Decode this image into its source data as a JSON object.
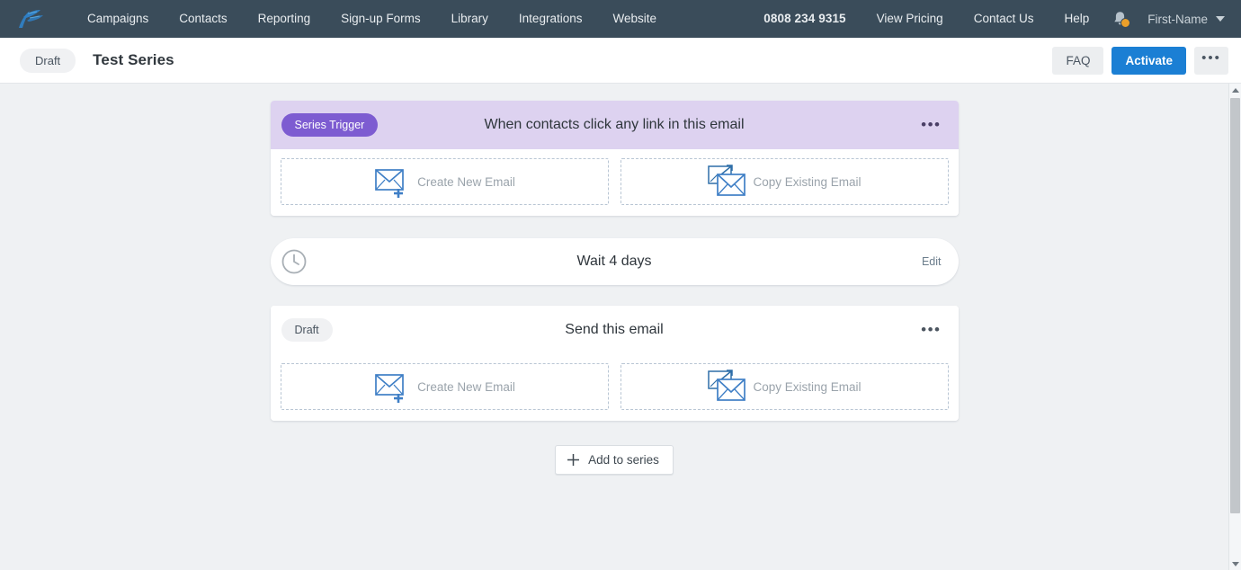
{
  "navbar": {
    "logo_icon": "flag-logo-icon",
    "left_links": [
      {
        "label": "Campaigns",
        "name": "nav-campaigns"
      },
      {
        "label": "Contacts",
        "name": "nav-contacts"
      },
      {
        "label": "Reporting",
        "name": "nav-reporting"
      },
      {
        "label": "Sign-up Forms",
        "name": "nav-signup-forms"
      },
      {
        "label": "Library",
        "name": "nav-library"
      },
      {
        "label": "Integrations",
        "name": "nav-integrations"
      },
      {
        "label": "Website",
        "name": "nav-website"
      }
    ],
    "phone": "0808 234 9315",
    "right_links": [
      {
        "label": "View Pricing",
        "name": "nav-view-pricing"
      },
      {
        "label": "Contact Us",
        "name": "nav-contact-us"
      },
      {
        "label": "Help",
        "name": "nav-help"
      }
    ],
    "bell_icon": "notification-bell-icon",
    "bell_badge_color": "#eca02a",
    "user_name": "First-Name",
    "background_color": "#3a4c5a"
  },
  "subheader": {
    "status_label": "Draft",
    "title": "Test Series",
    "faq_label": "FAQ",
    "activate_label": "Activate",
    "overflow_label": "•••",
    "primary_color": "#1b7fd4"
  },
  "series": {
    "trigger_card": {
      "pill_label": "Series Trigger",
      "title": "When contacts click any link in this email",
      "overflow_label": "•••",
      "header_color": "#ddd2f0",
      "pill_color": "#7d5cd1",
      "choices": [
        {
          "label": "Create New Email",
          "icon": "new-email-icon"
        },
        {
          "label": "Copy Existing Email",
          "icon": "copy-email-icon"
        }
      ]
    },
    "wait_step": {
      "icon": "clock-icon",
      "title": "Wait 4 days",
      "edit_label": "Edit"
    },
    "email_card": {
      "pill_label": "Draft",
      "title": "Send this email",
      "overflow_label": "•••",
      "choices": [
        {
          "label": "Create New Email",
          "icon": "new-email-icon"
        },
        {
          "label": "Copy Existing Email",
          "icon": "copy-email-icon"
        }
      ]
    },
    "add_button": {
      "label": "Add to series",
      "icon": "plus-icon"
    }
  }
}
